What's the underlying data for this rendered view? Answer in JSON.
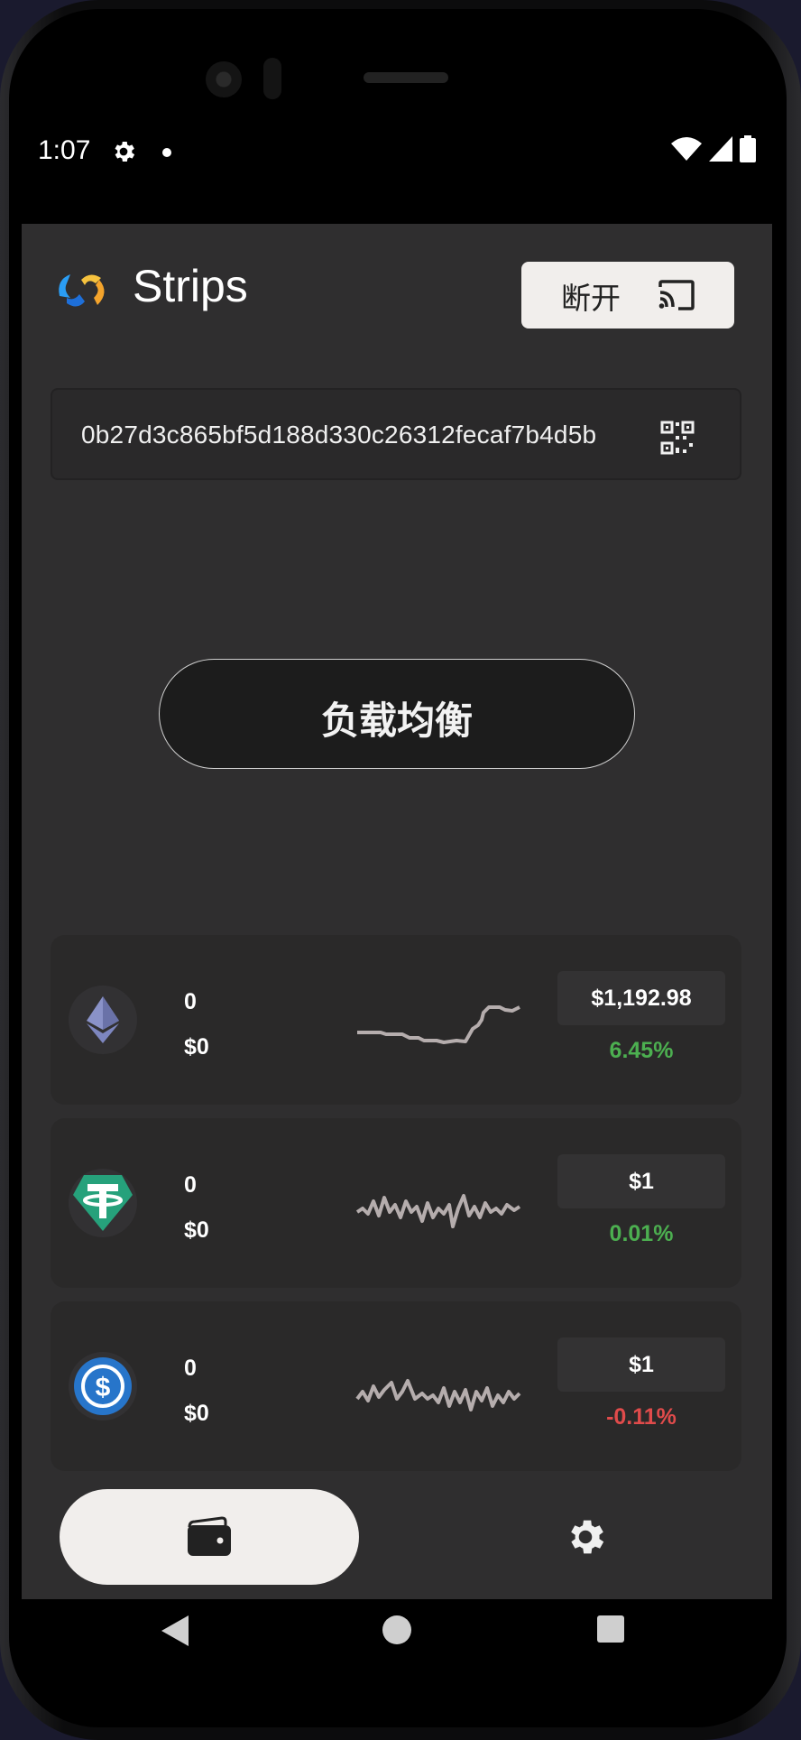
{
  "status_bar": {
    "time": "1:07"
  },
  "app": {
    "title": "Strips",
    "disconnect_label": "断开"
  },
  "wallet": {
    "address": "0b27d3c865bf5d188d330c26312fecaf7b4d5b"
  },
  "actions": {
    "load_balance_label": "负载均衡"
  },
  "tokens": [
    {
      "icon": "ethereum-icon",
      "amount": "0",
      "value": "$0",
      "price": "$1,192.98",
      "change": "6.45%",
      "change_color": "#4caf50"
    },
    {
      "icon": "tether-icon",
      "amount": "0",
      "value": "$0",
      "price": "$1",
      "change": "0.01%",
      "change_color": "#4caf50"
    },
    {
      "icon": "usdc-icon",
      "amount": "0",
      "value": "$0",
      "price": "$1",
      "change": "-0.11%",
      "change_color": "#e04b4b"
    }
  ],
  "bottom_nav": {
    "items": [
      "wallet-icon",
      "settings-icon"
    ],
    "active": "wallet-icon"
  },
  "colors": {
    "background": "#2f2e2f",
    "card": "#2a2929",
    "positive": "#4caf50",
    "negative": "#e04b4b",
    "sparkline": "#b5adad"
  }
}
